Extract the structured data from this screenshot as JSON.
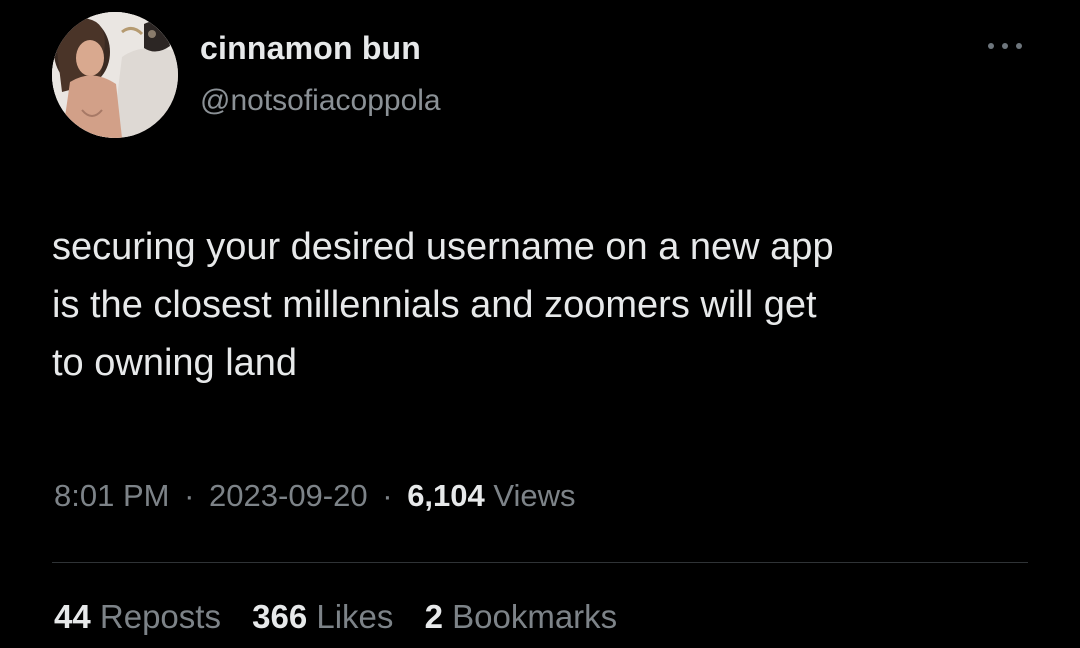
{
  "author": {
    "display_name": "cinnamon bun",
    "handle": "@notsofiacoppola"
  },
  "tweet": {
    "text": "securing your desired username on a new app\nis the closest millennials and zoomers will get\nto owning land"
  },
  "meta": {
    "time": "8:01 PM",
    "separator": "·",
    "date": "2023-09-20",
    "views_count": "6,104",
    "views_label": "Views"
  },
  "stats": {
    "reposts_count": "44",
    "reposts_label": "Reposts",
    "likes_count": "366",
    "likes_label": "Likes",
    "bookmarks_count": "2",
    "bookmarks_label": "Bookmarks"
  },
  "icons": {
    "more": "more-options-icon"
  },
  "colors": {
    "background": "#000000",
    "primary_text": "#e7e9ea",
    "secondary_text": "#7d8388",
    "divider": "#2f3336"
  }
}
